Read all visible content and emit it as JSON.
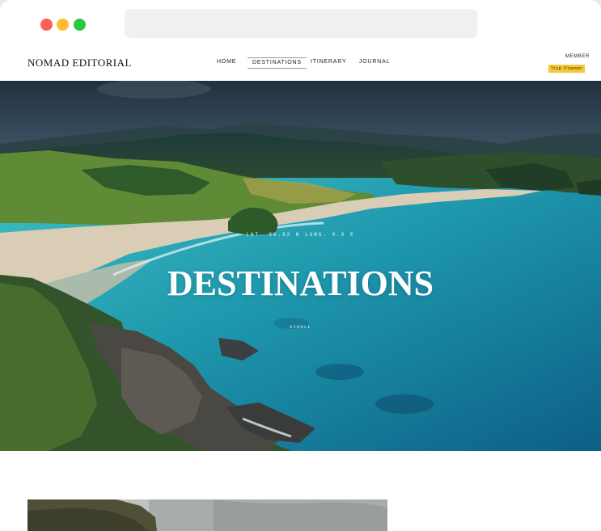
{
  "site": {
    "logo": "NOMAD EDITORIAL"
  },
  "nav": {
    "items": [
      {
        "label": "HOME"
      },
      {
        "label": "DESTINATIONS",
        "active": true
      },
      {
        "label": "ITINERARY"
      },
      {
        "label": "JOURNAL"
      }
    ]
  },
  "account": {
    "member_label": "MEMBER",
    "trip_planner_label": "Trip Planner"
  },
  "hero": {
    "coords": "LAT. 36.82 N  LONG. 0.0 E",
    "title": "DESTINATIONS",
    "scroll_label": "SCROLL"
  },
  "colors": {
    "accent": "#f5c83a",
    "ocean": "#1f8fa6",
    "hero_text": "#ffffff"
  }
}
